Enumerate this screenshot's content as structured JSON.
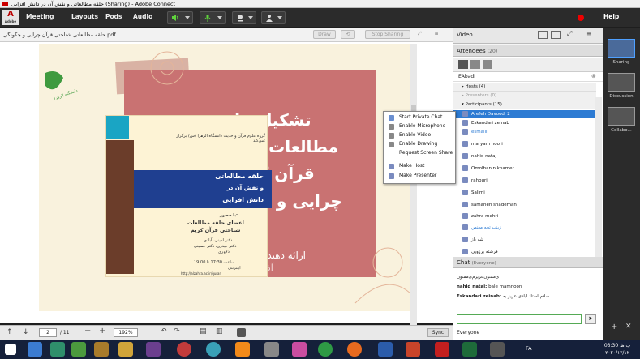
{
  "window": {
    "title": "حلقه مطالعاتی و نقش آن در دانش افزایی (Sharing) - Adobe Connect"
  },
  "menubar": {
    "logo_text": "Adobe",
    "items": [
      "Meeting",
      "Layouts",
      "Pods",
      "Audio"
    ],
    "help": "Help"
  },
  "share_pod": {
    "file_name": "حلقه مطالعاتی شناختی قرآن چرایی و چگونگی.pdf",
    "buttons": {
      "draw": "Draw",
      "stop_sharing": "Stop Sharing"
    },
    "footer": {
      "page_current": "2",
      "page_total": "/ 11",
      "zoom": "192%",
      "sync": "Sync"
    }
  },
  "slide": {
    "title_lines": [
      "تشکیل حلقه",
      "مطالعات شناختی",
      "قرآن کریم",
      "چرایی و چگونگی"
    ],
    "presenter": "ارائه دهنده: فاطمه آبادی",
    "date": "آذر 1399",
    "logo_text": "دانشگاه الزهرا",
    "poster": {
      "intro": "گروه علوم قرآن و حدیث دانشگاه الزهرا (س) برگزار می‌کند:",
      "title_lines": [
        "حلقه مطالعاتی",
        "و نقش آن در",
        "دانش افزایی"
      ],
      "with": "با حضور:",
      "subtitle_lines": [
        "اعضای حلقه مطالعات",
        "شناختی قرآن کریم"
      ],
      "names": [
        "دکتر امینی، آبادی",
        "دکتر حیدری، دکتر حسینی",
        "دلاوری"
      ],
      "time": "ساعت 17:30 تا 19:00",
      "place": "اینترنتی",
      "url": "http://alzahra.ac.ir/quran"
    }
  },
  "video_pod": {
    "title": "Video"
  },
  "attendees_pod": {
    "title": "Attendees",
    "count": "(20)",
    "me": "EAbadi",
    "hosts": "Hosts (4)",
    "presenters": "Presenters (0)",
    "participants": "Participants (15)",
    "people": [
      "Arefeh Davoodi 2",
      "Eskandari zeinab",
      "esmaili",
      "maryam noori",
      "nahid nataj",
      "Omolbanin khamer",
      "rahouri",
      "Salimi",
      "samaneh shademan",
      "zahra mehri",
      "زینب تحه معنص",
      "شه باز",
      "فرشته برزویی"
    ]
  },
  "context_menu": {
    "items": [
      "Start Private Chat",
      "Enable Microphone",
      "Enable Video",
      "Enable Drawing",
      "Request Screen Share",
      "Make Host",
      "Make Presenter"
    ]
  },
  "chat_pod": {
    "title": "Chat",
    "scope": "(Everyone)",
    "messages": [
      {
        "text": "ی‌ممنون‌عزیزم‌ی‌ممنون"
      },
      {
        "author": "nahid nataj:",
        "text": "bale mamnoon"
      },
      {
        "author": "Eskandari zeinab:",
        "text": "سلام استاد ابادی عزیز به"
      }
    ],
    "tab": "Everyone"
  },
  "layouts": {
    "items": [
      "Sharing",
      "Discussion",
      "Collabo..."
    ]
  },
  "taskbar": {
    "lang": "FA",
    "time": "03:30 ب.ظ",
    "date": "۲۰۲۰/۱۲/۱۲"
  },
  "colors": {
    "accent": "#2d7bd3",
    "slide_bg": "#f9f2dd",
    "slide_pink": "#c97272",
    "poster_blue": "#1f3f90"
  }
}
